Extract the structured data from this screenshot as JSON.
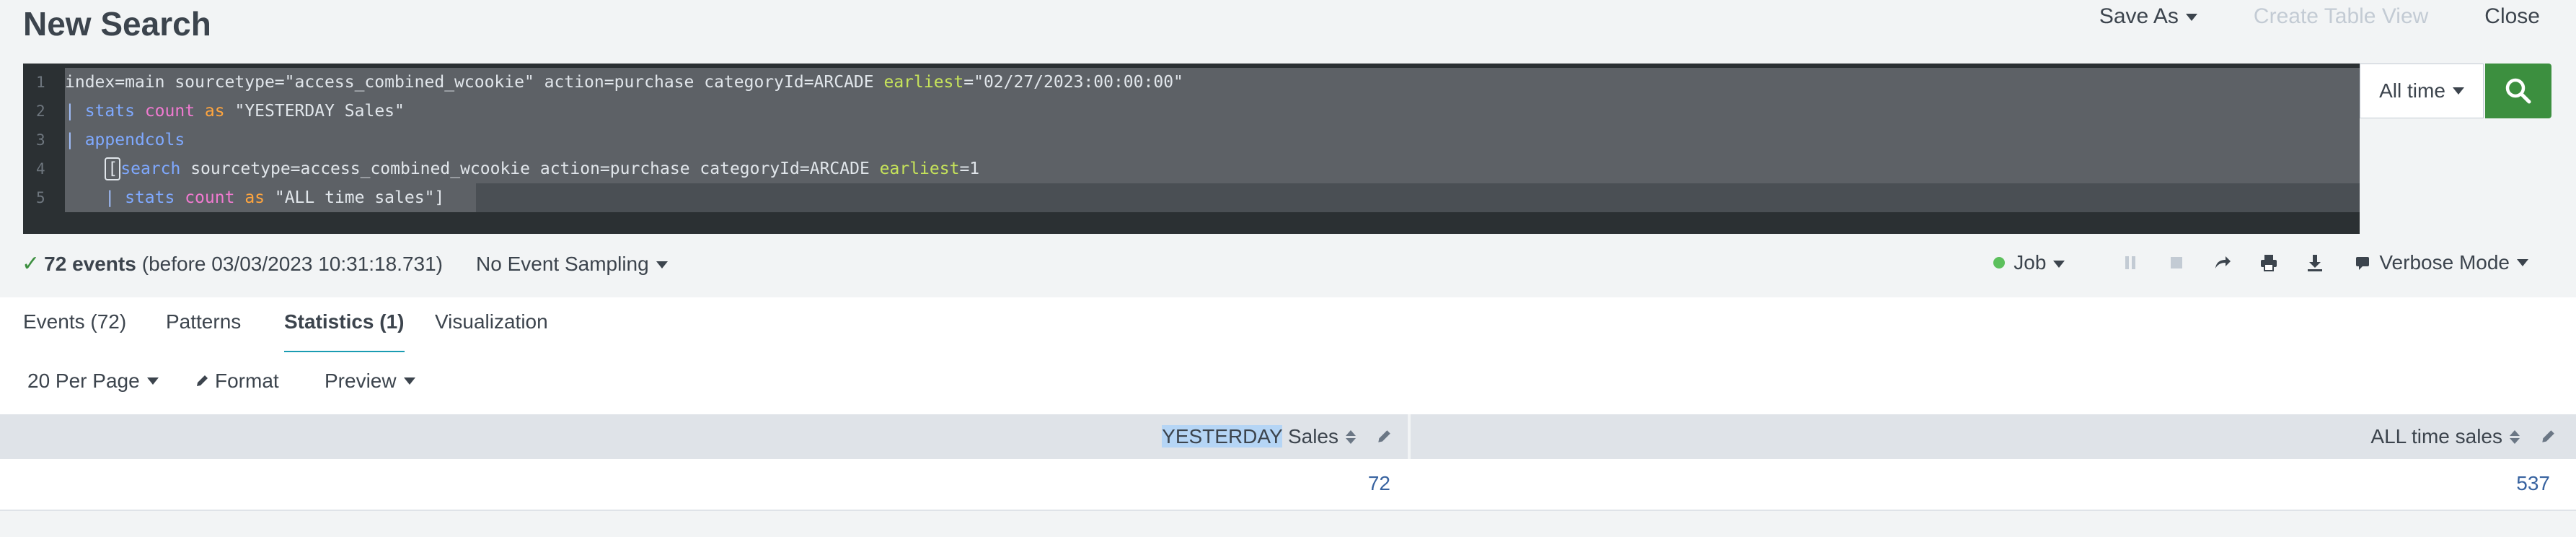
{
  "header": {
    "title": "New Search",
    "save_as": "Save As",
    "create_table_view": "Create Table View",
    "close": "Close"
  },
  "editor": {
    "lines": [
      {
        "num": "1",
        "segments": [
          {
            "t": "index=main sourcetype=\"access_combined_wcookie\" action=purchase categoryId=ARCADE ",
            "c": "str"
          },
          {
            "t": "earliest",
            "c": "kw"
          },
          {
            "t": "=\"02/27/2023:00:00:00\"",
            "c": "str"
          }
        ]
      },
      {
        "num": "2",
        "segments": [
          {
            "t": "| ",
            "c": "pipe"
          },
          {
            "t": "stats",
            "c": "cmd"
          },
          {
            "t": " ",
            "c": "str"
          },
          {
            "t": "count",
            "c": "fn"
          },
          {
            "t": " ",
            "c": "str"
          },
          {
            "t": "as",
            "c": "as"
          },
          {
            "t": " \"YESTERDAY Sales\"",
            "c": "str"
          }
        ]
      },
      {
        "num": "3",
        "segments": [
          {
            "t": "| ",
            "c": "pipe"
          },
          {
            "t": "appendcols",
            "c": "cmd"
          }
        ]
      },
      {
        "num": "4",
        "segments": [
          {
            "t": "    ",
            "c": "str"
          },
          {
            "t": "[",
            "c": "cursor"
          },
          {
            "t": "search",
            "c": "cmd"
          },
          {
            "t": " sourcetype=access_combined_wcookie action=purchase categoryId=ARCADE ",
            "c": "str"
          },
          {
            "t": "earliest",
            "c": "kw"
          },
          {
            "t": "=1",
            "c": "str"
          }
        ]
      },
      {
        "num": "5",
        "segments": [
          {
            "t": "    | ",
            "c": "pipe"
          },
          {
            "t": "stats",
            "c": "cmd"
          },
          {
            "t": " ",
            "c": "str"
          },
          {
            "t": "count",
            "c": "fn"
          },
          {
            "t": " ",
            "c": "str"
          },
          {
            "t": "as",
            "c": "as"
          },
          {
            "t": " \"ALL time sales\"]",
            "c": "str"
          }
        ]
      }
    ]
  },
  "time_picker": {
    "label": "All time"
  },
  "status": {
    "events_count": "72 events",
    "events_meta": "(before 03/03/2023 10:31:18.731)",
    "sampling": "No Event Sampling",
    "job": "Job",
    "mode": "Verbose Mode"
  },
  "tabs": [
    {
      "label": "Events (72)",
      "active": false
    },
    {
      "label": "Patterns",
      "active": false
    },
    {
      "label": "Statistics (1)",
      "active": true
    },
    {
      "label": "Visualization",
      "active": false
    }
  ],
  "controls": {
    "per_page": "20 Per Page",
    "format": "Format",
    "preview": "Preview"
  },
  "table": {
    "columns": [
      {
        "highlight": "YESTERDAY",
        "rest": " Sales"
      },
      {
        "highlight": "",
        "rest": "ALL time sales"
      }
    ],
    "rows": [
      [
        "72",
        "537"
      ]
    ]
  },
  "colors": {
    "search_button": "#3c8f3f",
    "active_tab_underline": "#1a9cb2",
    "editor_bg": "#2b3033",
    "link_value": "#3863a0"
  }
}
